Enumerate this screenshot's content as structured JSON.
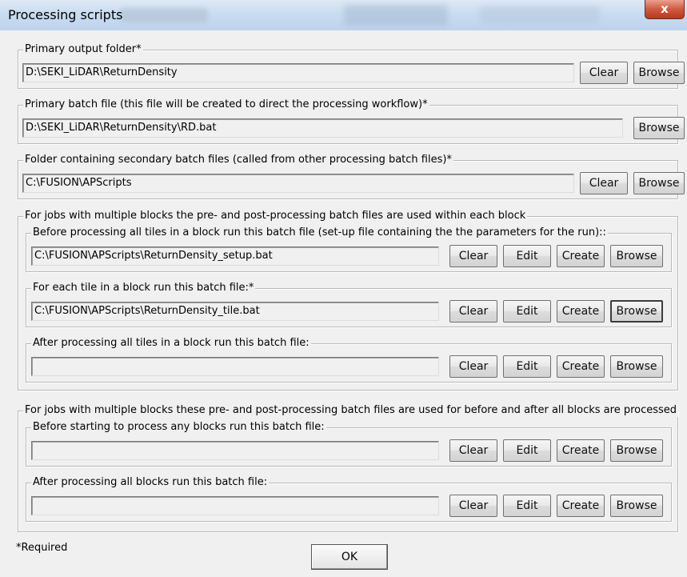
{
  "window": {
    "title": "Processing scripts",
    "close_glyph": "x"
  },
  "buttons": {
    "clear": "Clear",
    "browse": "Browse",
    "edit": "Edit",
    "create": "Create",
    "ok": "OK"
  },
  "primary_output": {
    "label": "Primary output folder*",
    "value": "D:\\SEKI_LiDAR\\ReturnDensity"
  },
  "primary_batch": {
    "label": "Primary batch file (this file will be created to direct the processing workflow)*",
    "value": "D:\\SEKI_LiDAR\\ReturnDensity\\RD.bat"
  },
  "secondary_folder": {
    "label": "Folder containing secondary batch files (called from other processing batch files)*",
    "value": "C:\\FUSION\\APScripts"
  },
  "block_group": {
    "label": "For jobs with multiple blocks the pre- and post-processing batch files are used within each block",
    "before": {
      "label": "Before processing all tiles in a block run this batch file (set-up file containing the the parameters for the run)::",
      "value": "C:\\FUSION\\APScripts\\ReturnDensity_setup.bat"
    },
    "each": {
      "label": "For each tile in a block run this batch file:*",
      "value": "C:\\FUSION\\APScripts\\ReturnDensity_tile.bat"
    },
    "after": {
      "label": "After processing all tiles in a block run this batch file:",
      "value": ""
    }
  },
  "all_blocks_group": {
    "label": "For jobs with multiple blocks these pre- and post-processing batch files are used for before and after all blocks are processed",
    "before": {
      "label": "Before starting to process any blocks run this batch file:",
      "value": ""
    },
    "after": {
      "label": "After processing all blocks run this batch file:",
      "value": ""
    }
  },
  "required_note": "*Required",
  "colors": {
    "window_bg": "#f0f0f0",
    "titlebar": "#c9dcf0",
    "close_button": "#cf5a3f"
  }
}
